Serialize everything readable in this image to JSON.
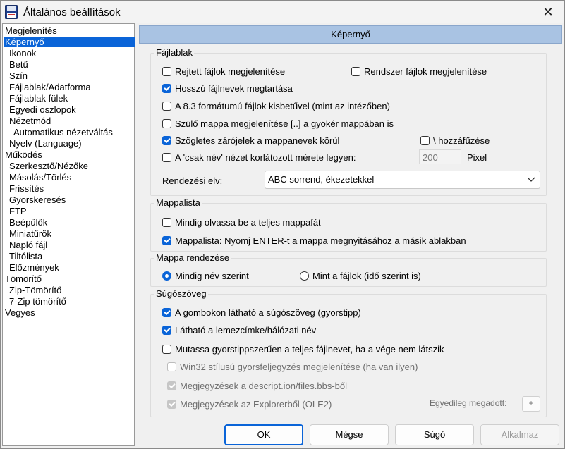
{
  "window": {
    "title": "Általános beállítások"
  },
  "tree": [
    {
      "label": "Megjelenítés"
    },
    {
      "label": "Képernyő",
      "selected": true
    },
    {
      "label": "Ikonok"
    },
    {
      "label": "Betű"
    },
    {
      "label": "Szín"
    },
    {
      "label": "Fájlablak/Adatforma"
    },
    {
      "label": "Fájlablak fülek"
    },
    {
      "label": "Egyedi oszlopok"
    },
    {
      "label": "Nézetmód"
    },
    {
      "label": "Automatikus nézetváltás"
    },
    {
      "label": "Nyelv (Language)"
    },
    {
      "label": "Működés"
    },
    {
      "label": "Szerkesztő/Nézőke"
    },
    {
      "label": "Másolás/Törlés"
    },
    {
      "label": "Frissítés"
    },
    {
      "label": "Gyorskeresés"
    },
    {
      "label": "FTP"
    },
    {
      "label": "Beépülők"
    },
    {
      "label": "Miniatűrök"
    },
    {
      "label": "Napló fájl"
    },
    {
      "label": "Tiltólista"
    },
    {
      "label": "Előzmények"
    },
    {
      "label": "Tömörítő"
    },
    {
      "label": "Zip-Tömörítő"
    },
    {
      "label": "7-Zip tömörítő"
    },
    {
      "label": "Vegyes"
    }
  ],
  "panel": {
    "header": "Képernyő",
    "fajlablak": {
      "label": "Fájlablak",
      "rejtett": {
        "label": "Rejtett fájlok megjelenítése",
        "checked": false
      },
      "rendszer": {
        "label": "Rendszer fájlok megjelenítése",
        "checked": false
      },
      "hosszu": {
        "label": "Hosszú fájlnevek megtartása",
        "checked": true
      },
      "kisbetu": {
        "label": "A 8.3 formátumú fájlok kisbetűvel (mint az intézőben)",
        "checked": false
      },
      "szulo": {
        "label": "Szülő mappa megjelenítése [..] a gyökér mappában is",
        "checked": false
      },
      "szogletes": {
        "label": "Szögletes zárójelek a mappanevek körül",
        "checked": true
      },
      "hozzafuzes": {
        "label": "\\ hozzáfűzése",
        "checked": false
      },
      "csaknev": {
        "label": "A 'csak név' nézet korlátozott mérete legyen:",
        "checked": false
      },
      "pixel_value": "200",
      "pixel_unit": "Pixel",
      "sort_label": "Rendezési elv:",
      "sort_value": "ABC sorrend, ékezetekkel"
    },
    "mappalista": {
      "label": "Mappalista",
      "teljes": {
        "label": "Mindig olvassa be a teljes mappafát",
        "checked": false
      },
      "enter": {
        "label": "Mappalista: Nyomj ENTER-t a mappa megnyitásához a másik ablakban",
        "checked": true
      }
    },
    "rendezes": {
      "label": "Mappa rendezése",
      "nev": {
        "label": "Mindig név szerint",
        "selected": true
      },
      "fajlok": {
        "label": "Mint a fájlok (idő szerint is)",
        "selected": false
      }
    },
    "sugo": {
      "label": "Súgószöveg",
      "gombokon": {
        "label": "A gombokon látható a súgószöveg (gyorstipp)",
        "checked": true
      },
      "lemez": {
        "label": "Látható a lemezcímke/hálózati név",
        "checked": true
      },
      "gyorstipp": {
        "label": "Mutassa gyorstippszerűen a teljes fájlnevet, ha a vége nem látszik",
        "checked": false
      },
      "win32": {
        "label": "Win32 stílusú gyorsfeljegyzés megjelenítése (ha van ilyen)",
        "checked": false
      },
      "descript": {
        "label": "Megjegyzések a descript.ion/files.bbs-ből",
        "checked": true
      },
      "explorer": {
        "label": "Megjegyzések az Explorerből (OLE2)",
        "checked": true
      },
      "egyedileg": "Egyedileg megadott:",
      "egyedileg_btn": "+"
    }
  },
  "buttons": {
    "ok": "OK",
    "cancel": "Mégse",
    "help": "Súgó",
    "apply": "Alkalmaz"
  }
}
